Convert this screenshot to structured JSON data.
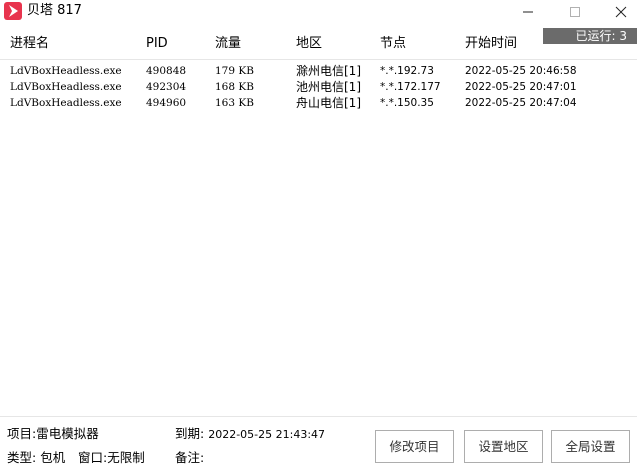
{
  "window": {
    "title": "贝塔 817",
    "app_icon": "arrow-logo-icon",
    "accent_color": "#e8344e"
  },
  "status": {
    "running": "已运行: 3"
  },
  "table": {
    "columns": [
      "进程名",
      "PID",
      "流量",
      "地区",
      "节点",
      "开始时间"
    ],
    "rows": [
      {
        "process": "LdVBoxHeadless.exe",
        "pid": "490848",
        "flow": "179 KB",
        "region": "滁州电信[1]",
        "node": "*.*.192.73",
        "start": "2022-05-25 20:46:58"
      },
      {
        "process": "LdVBoxHeadless.exe",
        "pid": "492304",
        "flow": "168 KB",
        "region": "池州电信[1]",
        "node": "*.*.172.177",
        "start": "2022-05-25 20:47:01"
      },
      {
        "process": "LdVBoxHeadless.exe",
        "pid": "494960",
        "flow": "163 KB",
        "region": "舟山电信[1]",
        "node": "*.*.150.35",
        "start": "2022-05-25 20:47:04"
      }
    ]
  },
  "footer": {
    "project_label": "项目:",
    "project_value": "雷电模拟器",
    "expire_label": "到期:",
    "expire_value": "2022-05-25 21:43:47",
    "type_label": "类型:",
    "type_value": "包机",
    "window_label": "窗口:",
    "window_value": "无限制",
    "remark_label": "备注:",
    "remark_value": ""
  },
  "buttons": {
    "edit_project": "修改项目",
    "set_region": "设置地区",
    "global_settings": "全局设置"
  }
}
